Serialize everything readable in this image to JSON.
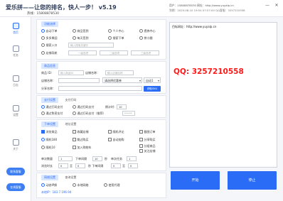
{
  "titlebar": {
    "app_title": "爱乐拼——让您的排名，快人一步！ v5.19",
    "hotline": "热线：15808878530",
    "user_line1": "用户：15808878530      网址：http://www.yuyalp.cn",
    "user_line2": "到期：2025-08-10 19:54 07:57:00  QQ客服：3257210558",
    "minimize": "—",
    "close": "✕"
  },
  "sidebar": {
    "items": [
      {
        "label": "首页",
        "icon": "grid-icon"
      },
      {
        "label": "任务",
        "icon": "task-icon"
      },
      {
        "label": "日志",
        "icon": "log-icon"
      },
      {
        "label": "设置",
        "icon": "settings-icon"
      },
      {
        "label": "关于",
        "icon": "about-icon"
      }
    ],
    "btn_top": "联系客服",
    "btn_bottom": "在线客服"
  },
  "func": {
    "tab": "功能选择",
    "row1": [
      "自动下单",
      "商品签到",
      "个人中心",
      "提券中心"
    ],
    "row2": [
      "多多果园",
      "每天签到",
      "搜索下单",
      "拼小圈"
    ],
    "row3_prefix": "搜索入口",
    "row3_placeholder": "输入搜索关键字",
    "row4_prefix": "店铺导航",
    "row4_fields": [
      "一级选项",
      "二级选项",
      "三级选项"
    ]
  },
  "product": {
    "tab": "商品信息",
    "id_label": "商品 ID：",
    "id_placeholder": "输入商品ID",
    "shop_label": "店铺名称：",
    "shop_placeholder": "输入店铺名称",
    "title_label": "店铺名称：",
    "coupon_select": "请选择优惠券",
    "auto_select": "自动1",
    "spec_label": "分享名称：",
    "fetch_btn": "获取SKU"
  },
  "pay": {
    "tabs": [
      "支付设置",
      "支付打码"
    ],
    "row1": [
      "通过打码支付",
      "通过扫码支付"
    ],
    "countdown_label": "倒计时：",
    "countdown_value": "10",
    "row2": [
      "通过免密支付",
      "通过打码支付（推荐）"
    ],
    "pwd_placeholder": "******"
  },
  "order": {
    "tabs": [
      "下单设置",
      "地址设置"
    ],
    "row1": [
      "浏览商品",
      "收藏店铺",
      "随机评论",
      "截图订单"
    ],
    "row2": [
      "随机180",
      "跳过购买",
      "自动加购",
      "分享购买"
    ],
    "row2_last": "随机下单",
    "row3": [
      "随机10",
      "加入购物车"
    ],
    "row3_extra": [
      "分组商品",
      "关注店铺"
    ],
    "qty_label": "单次数量",
    "qty_value": "1",
    "mode_label": "下单间隔",
    "mode_value": "10",
    "unit_label": "秒",
    "per_label": "单次任务",
    "per_value": "1",
    "interval_label": "浏览时长",
    "interval_value": "0",
    "to": "至",
    "interval_to": "0",
    "stop_label": "秒 下单间隔",
    "stop_value": "0",
    "stop_to": "0"
  },
  "network": {
    "tabs": [
      "网络设置",
      "查询设置"
    ],
    "options": [
      "动态IP换",
      "本地网络",
      "使用代理"
    ],
    "ip_label": "本地IP：183.7.196.94"
  },
  "right_panel": {
    "url": "目标网址：http://www.yuyalp.cn",
    "qq": "QQ:  3257210558",
    "start_btn": "开始",
    "stop_btn": "停止"
  }
}
